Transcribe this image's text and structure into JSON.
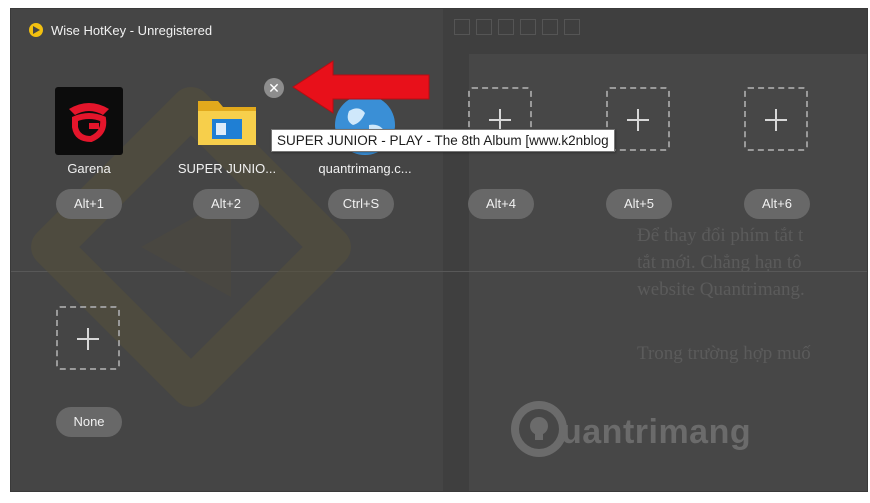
{
  "window": {
    "title": "Wise HotKey - Unregistered"
  },
  "colors": {
    "window_bg": "#454545",
    "hotkey_pill": "#686868",
    "arrow": "#e8101a",
    "app_icon": "#f2c010"
  },
  "slots": [
    {
      "name": "Garena",
      "hotkey": "Alt+1",
      "icon": "garena-icon"
    },
    {
      "name": "SUPER JUNIO...",
      "hotkey": "Alt+2",
      "icon": "folder-icon"
    },
    {
      "name": "quantrimang.c...",
      "hotkey": "Ctrl+S",
      "icon": "globe-icon"
    },
    {
      "name": "",
      "hotkey": "Alt+4",
      "icon": "plus-icon"
    },
    {
      "name": "",
      "hotkey": "Alt+5",
      "icon": "plus-icon"
    },
    {
      "name": "",
      "hotkey": "Alt+6",
      "icon": "plus-icon"
    },
    {
      "name": "",
      "hotkey": "None",
      "icon": "plus-icon"
    }
  ],
  "tooltip": {
    "text": "SUPER JUNIOR - PLAY - The 8th Album [www.k2nblog"
  },
  "background_text": {
    "line1": "Để thay đổi phím tắt t",
    "line2": "tắt mới. Chẳng hạn tô",
    "line3": "website Quantrimang.",
    "line4": "Trong trường hợp muố"
  },
  "watermark": {
    "text": "uantrimang"
  }
}
